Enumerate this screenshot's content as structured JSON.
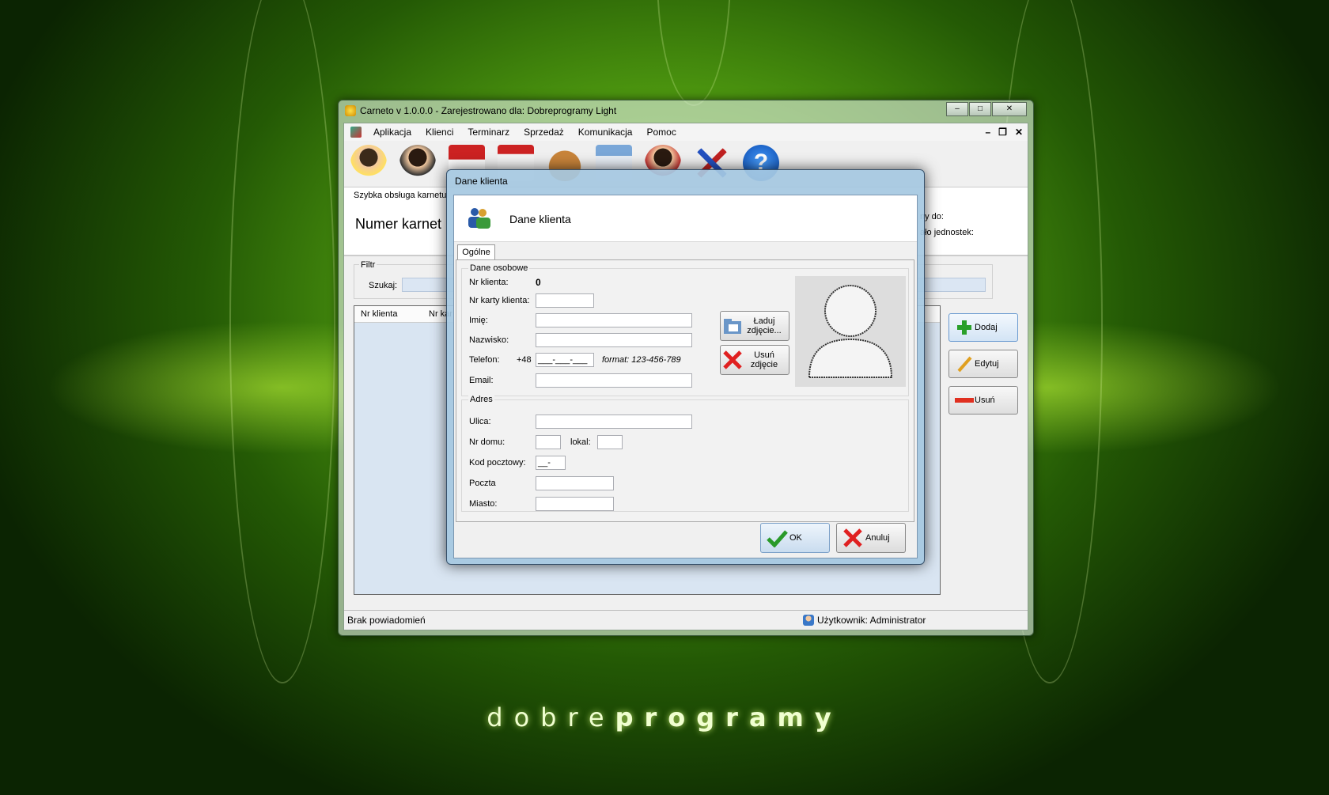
{
  "window": {
    "title": "Carneto v 1.0.0.0 - Zarejestrowano dla: Dobreprogramy Light",
    "menu": [
      "Aplikacja",
      "Klienci",
      "Terminarz",
      "Sprzedaż",
      "Komunikacja",
      "Pomoc"
    ],
    "toolbar_icons": [
      "add-client-icon",
      "clients-icon",
      "calendar-april-icon",
      "calendar-12-icon",
      "money-bag-icon",
      "card-icon",
      "person-icon",
      "tools-icon",
      "help-icon"
    ]
  },
  "quick": {
    "title": "Szybka obsługa karnetu",
    "number_label": "Numer karnet",
    "valid_to": "ny do:",
    "remaining": "ało jednostek:"
  },
  "filter": {
    "legend": "Filtr",
    "search_label": "Szukaj:"
  },
  "grid": {
    "columns": [
      "Nr klienta",
      "Nr kar"
    ]
  },
  "side_buttons": {
    "add": "Dodaj",
    "edit": "Edytuj",
    "delete": "Usuń"
  },
  "status": {
    "left": "Brak powiadomień",
    "user": "Użytkownik: Administrator"
  },
  "dialog": {
    "title": "Dane klienta",
    "header": "Dane klienta",
    "tab": "Ogólne",
    "personal": {
      "legend": "Dane osobowe",
      "client_no_label": "Nr klienta:",
      "client_no": "0",
      "card_label": "Nr karty klienta:",
      "first_name_label": "Imię:",
      "last_name_label": "Nazwisko:",
      "phone_label": "Telefon:",
      "phone_prefix": "+48",
      "phone_mask": "___-___-___",
      "phone_format": "format: 123-456-789",
      "email_label": "Email:"
    },
    "address": {
      "legend": "Adres",
      "street_label": "Ulica:",
      "house_label": "Nr domu:",
      "flat_label": "lokal:",
      "postal_label": "Kod pocztowy:",
      "postal_mask": "__-___",
      "post_label": "Poczta",
      "city_label": "Miasto:"
    },
    "load_photo": "Ładuj zdjęcie...",
    "remove_photo": "Usuń zdjęcie",
    "ok": "OK",
    "cancel": "Anuluj"
  },
  "brand": {
    "light": "dobre",
    "bold": "programy"
  }
}
